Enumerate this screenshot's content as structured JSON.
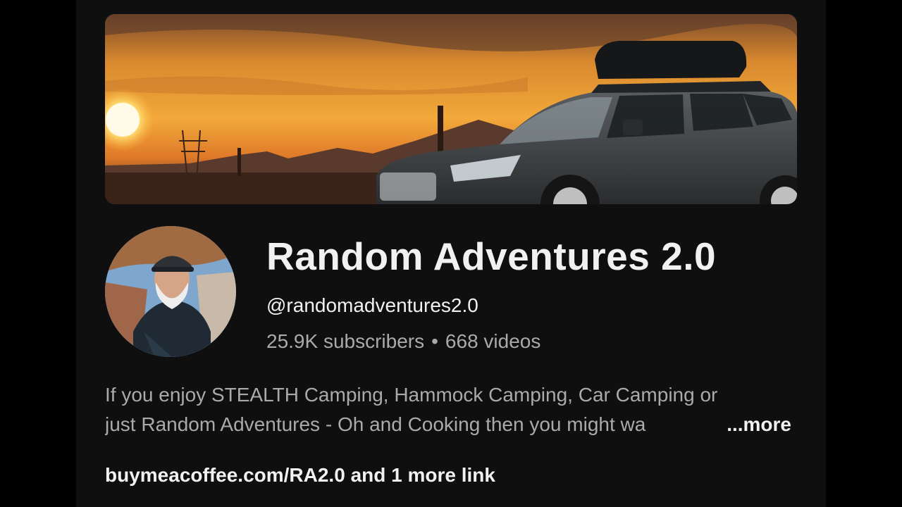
{
  "channel": {
    "title": "Random Adventures 2.0",
    "handle": "@randomadventures2.0",
    "subscribers": "25.9K subscribers",
    "separator": "•",
    "videos": "668 videos"
  },
  "description": {
    "line1": "If you enjoy STEALTH Camping, Hammock Camping, Car Camping or",
    "line2": "just Random Adventures - Oh and Cooking then you might wa",
    "more_label": "...more"
  },
  "links": {
    "primary": "buymeacoffee.com/RA2.0",
    "extra": " and 1 more link"
  },
  "colors": {
    "background": "#0f0f0f",
    "text_primary": "#f1f1f1",
    "text_secondary": "#aaaaaa"
  }
}
